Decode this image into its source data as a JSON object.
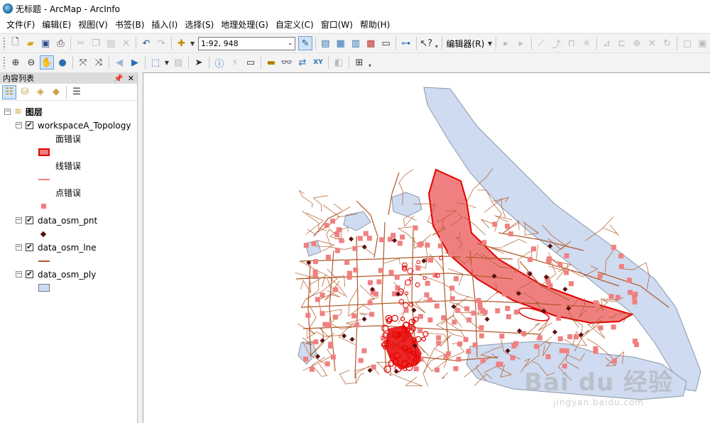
{
  "window": {
    "title": "无标题 - ArcMap - ArcInfo"
  },
  "menu": [
    "文件(F)",
    "编辑(E)",
    "视图(V)",
    "书签(B)",
    "插入(I)",
    "选择(S)",
    "地理处理(G)",
    "自定义(C)",
    "窗口(W)",
    "帮助(H)"
  ],
  "toolbar": {
    "scale": "1:92, 948",
    "editor_label": "编辑器(R)"
  },
  "toc": {
    "title": "内容列表",
    "root_label": "图层",
    "layers": [
      {
        "name": "workspaceA_Topology",
        "checked": true,
        "classes": [
          {
            "label": "面错误"
          },
          {
            "label": "线错误"
          },
          {
            "label": "点错误"
          }
        ]
      },
      {
        "name": "data_osm_pnt",
        "checked": true
      },
      {
        "name": "data_osm_lne",
        "checked": true
      },
      {
        "name": "data_osm_ply",
        "checked": true
      }
    ]
  },
  "colors": {
    "polygon_fill": "#cfdbf0",
    "polygon_stroke": "#8a96a8",
    "road": "#b05a28",
    "error_fill": "#f08080",
    "error_stroke": "#e60000",
    "point": "#5a1010"
  },
  "icons": {
    "toolbar1": [
      "new-document-icon",
      "open-folder-icon",
      "save-icon",
      "print-icon",
      "cut-icon",
      "copy-icon",
      "paste-icon",
      "delete-icon",
      "undo-icon",
      "redo-icon",
      "add-data-icon"
    ],
    "toolbar2": [
      "zoom-in-icon",
      "zoom-out-icon",
      "pan-icon",
      "full-extent-icon",
      "fixed-zoom-in-icon",
      "fixed-zoom-out-icon",
      "back-icon",
      "forward-icon",
      "select-features-icon",
      "clear-selection-icon",
      "select-elements-icon",
      "identify-icon",
      "hyperlink-icon",
      "html-popup-icon",
      "measure-icon",
      "find-icon",
      "find-route-icon",
      "go-to-xy-icon",
      "time-slider-icon",
      "create-viewer-icon"
    ]
  },
  "watermark": {
    "main": "Bai du 经验",
    "sub": "jingyan.baidu.com"
  }
}
